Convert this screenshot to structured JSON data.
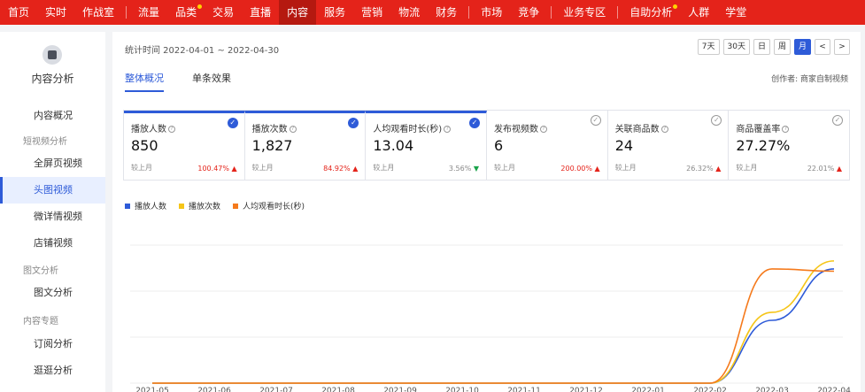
{
  "topnav": {
    "items": [
      {
        "label": "首页",
        "active": false,
        "dot": false
      },
      {
        "label": "实时",
        "active": false,
        "dot": false
      },
      {
        "label": "作战室",
        "active": false,
        "dot": false
      },
      {
        "sep": true
      },
      {
        "label": "流量",
        "active": false,
        "dot": false
      },
      {
        "label": "品类",
        "active": false,
        "dot": true
      },
      {
        "label": "交易",
        "active": false,
        "dot": false
      },
      {
        "label": "直播",
        "active": false,
        "dot": false
      },
      {
        "label": "内容",
        "active": true,
        "dot": false
      },
      {
        "label": "服务",
        "active": false,
        "dot": false
      },
      {
        "label": "营销",
        "active": false,
        "dot": false
      },
      {
        "label": "物流",
        "active": false,
        "dot": false
      },
      {
        "label": "财务",
        "active": false,
        "dot": false
      },
      {
        "sep": true
      },
      {
        "label": "市场",
        "active": false,
        "dot": false
      },
      {
        "label": "竞争",
        "active": false,
        "dot": false
      },
      {
        "sep": true
      },
      {
        "label": "业务专区",
        "active": false,
        "dot": false
      },
      {
        "sep": true
      },
      {
        "label": "自助分析",
        "active": false,
        "dot": true
      },
      {
        "label": "人群",
        "active": false,
        "dot": false
      },
      {
        "label": "学堂",
        "active": false,
        "dot": false
      }
    ]
  },
  "sidebar": {
    "title": "内容分析",
    "overview": "内容概况",
    "group_short_video": "短视频分析",
    "items_video": [
      "全屏页视频",
      "头图视频",
      "微详情视频",
      "店铺视频"
    ],
    "active_item": "头图视频",
    "group_article": "图文分析",
    "item_article": "图文分析",
    "group_topic": "内容专题",
    "items_topic": [
      "订阅分析",
      "逛逛分析"
    ]
  },
  "header": {
    "date_range": "统计时间 2022-04-01 ~ 2022-04-30",
    "periods": [
      "7天",
      "30天",
      "日",
      "周",
      "月"
    ],
    "active_period": "月",
    "prev": "<",
    "next": ">"
  },
  "tabs": [
    "整体概况",
    "单条效果"
  ],
  "creator": "创作者: 商家自制视频",
  "metrics": [
    {
      "label": "播放人数",
      "value": "850",
      "cmp": "较上月",
      "rate": "100.47%",
      "trend": "up",
      "selected": true
    },
    {
      "label": "播放次数",
      "value": "1,827",
      "cmp": "较上月",
      "rate": "84.92%",
      "trend": "up",
      "selected": true
    },
    {
      "label": "人均观看时长(秒)",
      "value": "13.04",
      "cmp": "较上月",
      "rate": "3.56%",
      "trend": "down",
      "selected": true
    },
    {
      "label": "发布视频数",
      "value": "6",
      "cmp": "较上月",
      "rate": "200.00%",
      "trend": "up",
      "selected": false
    },
    {
      "label": "关联商品数",
      "value": "24",
      "cmp": "较上月",
      "rate": "26.32%",
      "trend": "up",
      "selected": false
    },
    {
      "label": "商品覆盖率",
      "value": "27.27%",
      "cmp": "较上月",
      "rate": "22.01%",
      "trend": "up",
      "selected": false
    }
  ],
  "chart_data": {
    "type": "line",
    "x": [
      "2021-05",
      "2021-06",
      "2021-07",
      "2021-08",
      "2021-09",
      "2021-10",
      "2021-11",
      "2021-12",
      "2022-01",
      "2022-02",
      "2022-03",
      "2022-04"
    ],
    "series": [
      {
        "name": "播放人数",
        "color": "#2e5bd8",
        "values": [
          0,
          0,
          0,
          0,
          0,
          0,
          0,
          0,
          0,
          0,
          0.55,
          1.0
        ]
      },
      {
        "name": "播放次数",
        "color": "#f5c518",
        "values": [
          0,
          0,
          0,
          0,
          0,
          0,
          0,
          0,
          0,
          0,
          0.62,
          1.07
        ]
      },
      {
        "name": "人均观看时长(秒)",
        "color": "#f57a1c",
        "values": [
          0,
          0,
          0,
          0,
          0,
          0,
          0,
          0,
          0,
          0,
          1.0,
          0.98
        ]
      }
    ],
    "grid": true,
    "legend": "top-left"
  }
}
